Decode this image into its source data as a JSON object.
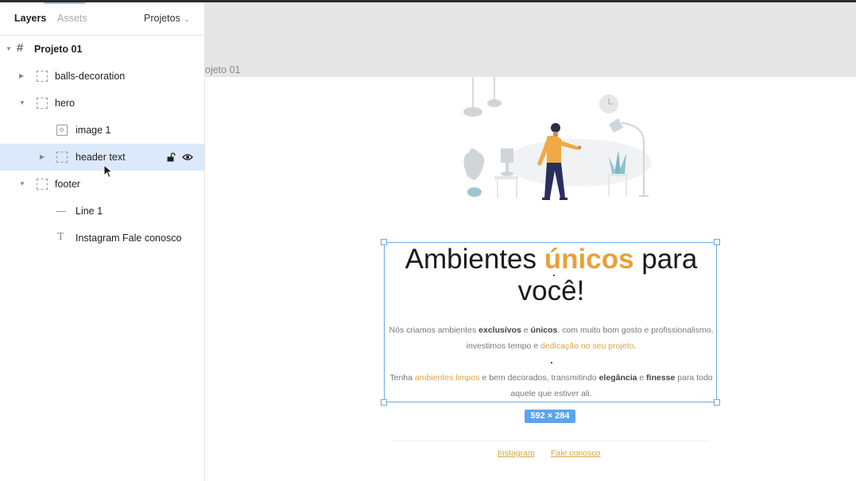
{
  "sidebar": {
    "tabs": {
      "layers": "Layers",
      "assets": "Assets"
    },
    "project_dropdown": "Projetos",
    "layers": [
      {
        "label": "Projeto 01",
        "icon": "hash-icon"
      },
      {
        "label": "balls-decoration",
        "icon": "frame-icon"
      },
      {
        "label": "hero",
        "icon": "frame-icon"
      },
      {
        "label": "image 1",
        "icon": "image-icon"
      },
      {
        "label": "header text",
        "icon": "frame-icon",
        "selected": true
      },
      {
        "label": "footer",
        "icon": "frame-icon"
      },
      {
        "label": "Line 1",
        "icon": "line-icon"
      },
      {
        "label": "Instagram Fale conosco",
        "icon": "text-icon"
      }
    ]
  },
  "canvas": {
    "frame_label": "ojeto 01",
    "headline": {
      "pre": "Ambientes ",
      "accent": "únicos",
      "post": " para você!"
    },
    "paragraph1": {
      "t1": "Nós criamos ambientes ",
      "b1": "exclusívos",
      "t2": " e ",
      "b2": "únicos",
      "t3": ", com muito bom gosto e profissionalismo, investimos tempo e ",
      "a1": "dedicação no seu projeto",
      "t4": "."
    },
    "paragraph2": {
      "t1": "Tenha ",
      "a1": "ambientes limpos",
      "t2": " e bem decorados, transmitindo ",
      "b1": "elegância",
      "t3": "  e ",
      "b2": "finesse",
      "t4": " para todo aquele que estiver ali."
    },
    "size_badge": "592 × 284",
    "footer_links": {
      "instagram": "Instagram",
      "contact": "Fale conosco"
    }
  },
  "colors": {
    "accent": "#e8a13a",
    "selection": "#6ea7e8",
    "badge": "#5ba4ee"
  }
}
